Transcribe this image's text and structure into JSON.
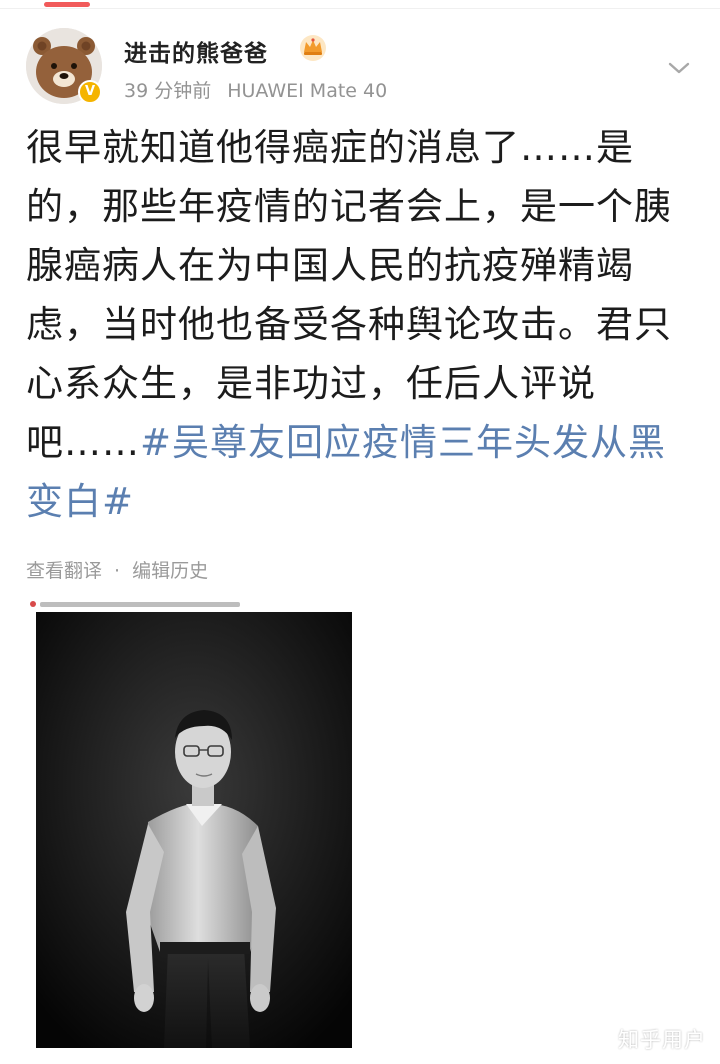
{
  "author": {
    "name": "进击的熊爸爸",
    "verified_mark": "V",
    "avatar_icon": "brown-bear-avatar",
    "badge_icon": "crown-icon"
  },
  "meta": {
    "time": "39 分钟前",
    "device": "HUAWEI Mate 40"
  },
  "post": {
    "body": "很早就知道他得癌症的消息了……是的，那些年疫情的记者会上，是一个胰腺癌病人在为中国人民的抗疫殚精竭虑，当时他也备受各种舆论攻击。君只心系众生，是非功过，任后人评说吧……",
    "hashtag": "#吴尊友回应疫情三年头发从黑变白#"
  },
  "actions": {
    "translate": "查看翻译",
    "separator": "·",
    "edit_history": "编辑历史"
  },
  "watermark": "知乎用户",
  "colors": {
    "hashtag": "#5b7fb0",
    "meta_text": "#939393",
    "accent_indicator": "#f15a5a"
  }
}
